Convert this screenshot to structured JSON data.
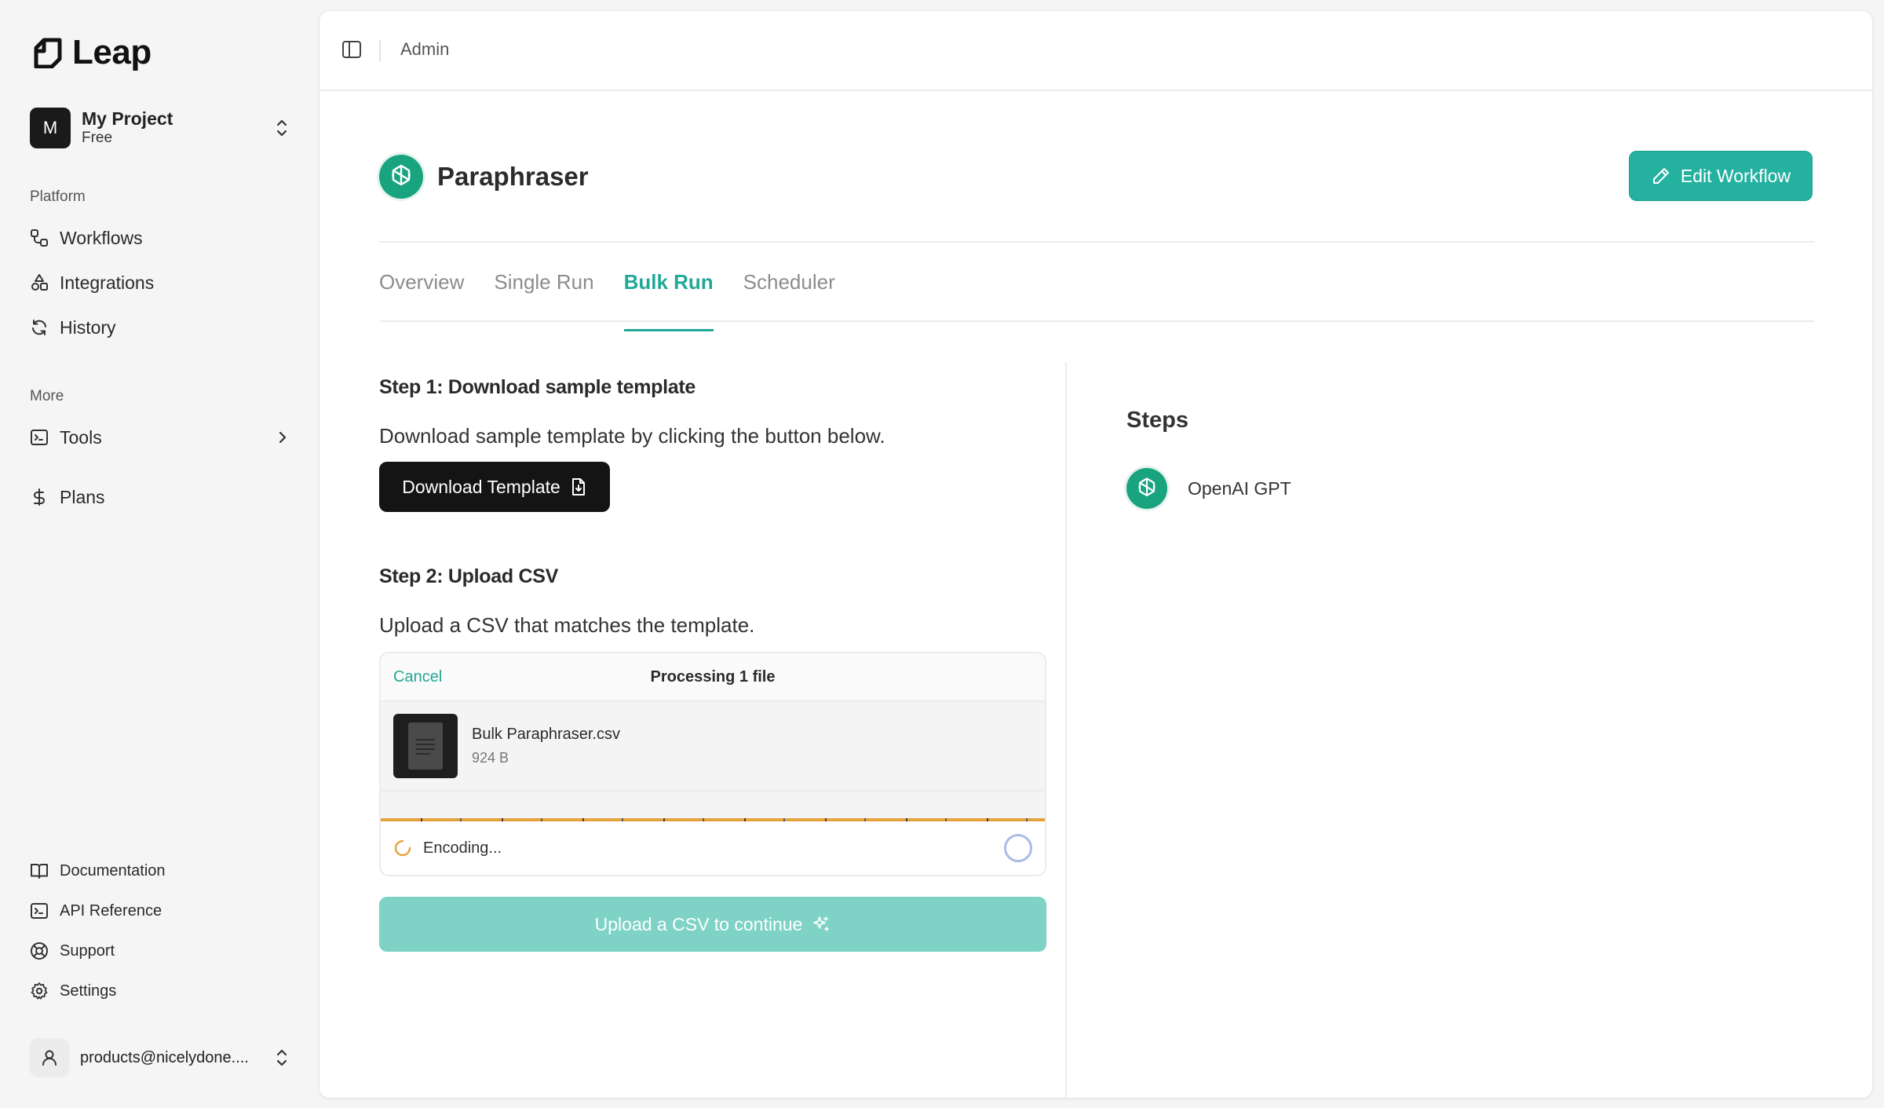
{
  "app": {
    "name": "Leap"
  },
  "project": {
    "avatar_letter": "M",
    "name": "My Project",
    "plan": "Free"
  },
  "sidebar": {
    "platform_label": "Platform",
    "platform_items": [
      {
        "label": "Workflows",
        "icon": "workflow-icon"
      },
      {
        "label": "Integrations",
        "icon": "shapes-icon"
      },
      {
        "label": "History",
        "icon": "refresh-icon"
      }
    ],
    "more_label": "More",
    "tools_label": "Tools",
    "plans_label": "Plans",
    "footer_items": [
      {
        "label": "Documentation",
        "icon": "book-icon"
      },
      {
        "label": "API Reference",
        "icon": "terminal-icon"
      },
      {
        "label": "Support",
        "icon": "lifebuoy-icon"
      },
      {
        "label": "Settings",
        "icon": "gear-icon"
      }
    ],
    "user_email": "products@nicelydone...."
  },
  "topbar": {
    "breadcrumb": "Admin"
  },
  "workflow": {
    "title": "Paraphraser",
    "edit_label": "Edit Workflow",
    "tabs": [
      {
        "label": "Overview",
        "active": false
      },
      {
        "label": "Single Run",
        "active": false
      },
      {
        "label": "Bulk Run",
        "active": true
      },
      {
        "label": "Scheduler",
        "active": false
      }
    ]
  },
  "bulk_run": {
    "step1_title": "Step 1: Download sample template",
    "step1_text": "Download sample template by clicking the button below.",
    "download_label": "Download Template",
    "step2_title": "Step 2: Upload CSV",
    "step2_text": "Upload a CSV that matches the template.",
    "uploader": {
      "cancel_label": "Cancel",
      "status": "Processing 1 file",
      "file_name": "Bulk Paraphraser.csv",
      "file_size": "924 B",
      "encoding_label": "Encoding..."
    },
    "continue_label": "Upload a CSV to continue"
  },
  "steps_panel": {
    "title": "Steps",
    "items": [
      {
        "label": "OpenAI GPT",
        "icon": "openai-icon"
      }
    ]
  },
  "colors": {
    "accent": "#21a898",
    "accent_button": "#25b1a0",
    "disabled_button": "#7ed3c6",
    "openai_green": "#19a37f",
    "progress": "#e6a23c"
  }
}
